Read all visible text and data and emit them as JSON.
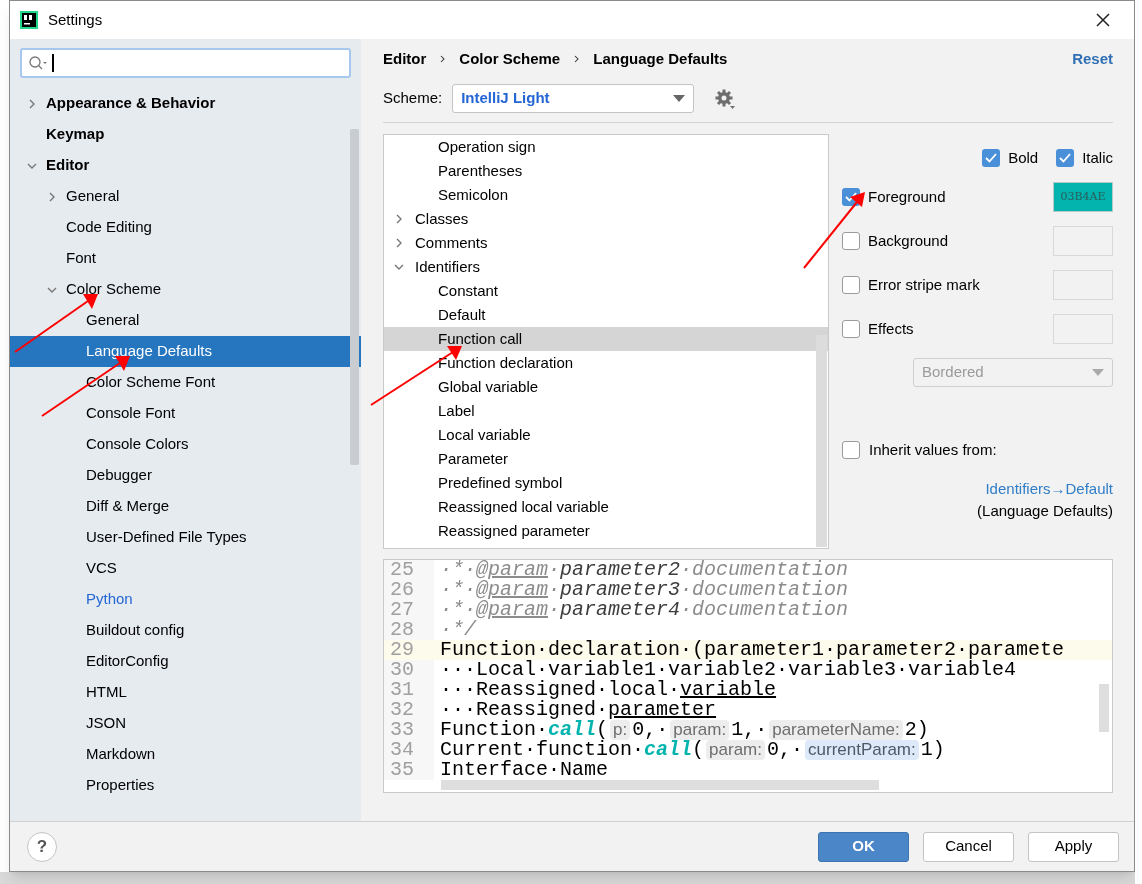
{
  "window": {
    "title": "Settings"
  },
  "sidebar": {
    "items": [
      {
        "label": "Appearance & Behavior",
        "kind": "folder",
        "expanded": false,
        "selected": false,
        "modified": false
      },
      {
        "label": "Keymap",
        "kind": "leaf",
        "selected": false,
        "modified": false
      },
      {
        "label": "Editor",
        "kind": "folder",
        "expanded": true,
        "selected": false,
        "modified": false,
        "children": [
          {
            "label": "General",
            "kind": "folder",
            "expanded": false,
            "selected": false,
            "modified": false
          },
          {
            "label": "Code Editing",
            "kind": "leaf",
            "selected": false,
            "modified": false
          },
          {
            "label": "Font",
            "kind": "leaf",
            "selected": false,
            "modified": false
          },
          {
            "label": "Color Scheme",
            "kind": "folder",
            "expanded": true,
            "selected": false,
            "modified": false,
            "children": [
              {
                "label": "General",
                "kind": "leaf",
                "selected": false,
                "modified": false
              },
              {
                "label": "Language Defaults",
                "kind": "leaf",
                "selected": true,
                "modified": false
              },
              {
                "label": "Color Scheme Font",
                "kind": "leaf",
                "selected": false,
                "modified": false
              },
              {
                "label": "Console Font",
                "kind": "leaf",
                "selected": false,
                "modified": false
              },
              {
                "label": "Console Colors",
                "kind": "leaf",
                "selected": false,
                "modified": false
              },
              {
                "label": "Debugger",
                "kind": "leaf",
                "selected": false,
                "modified": false
              },
              {
                "label": "Diff & Merge",
                "kind": "leaf",
                "selected": false,
                "modified": false
              },
              {
                "label": "User-Defined File Types",
                "kind": "leaf",
                "selected": false,
                "modified": false
              },
              {
                "label": "VCS",
                "kind": "leaf",
                "selected": false,
                "modified": false
              },
              {
                "label": "Python",
                "kind": "leaf",
                "selected": false,
                "modified": true
              },
              {
                "label": "Buildout config",
                "kind": "leaf",
                "selected": false,
                "modified": false
              },
              {
                "label": "EditorConfig",
                "kind": "leaf",
                "selected": false,
                "modified": false
              },
              {
                "label": "HTML",
                "kind": "leaf",
                "selected": false,
                "modified": false
              },
              {
                "label": "JSON",
                "kind": "leaf",
                "selected": false,
                "modified": false
              },
              {
                "label": "Markdown",
                "kind": "leaf",
                "selected": false,
                "modified": false
              },
              {
                "label": "Properties",
                "kind": "leaf",
                "selected": false,
                "modified": false
              }
            ]
          }
        ]
      }
    ]
  },
  "breadcrumb": [
    "Editor",
    "Color Scheme",
    "Language Defaults"
  ],
  "reset_link": "Reset",
  "scheme": {
    "label": "Scheme:",
    "value": "IntelliJ Light"
  },
  "attributes_tree": {
    "items": [
      {
        "kind": "continuation",
        "children": [
          {
            "label": "Operation sign",
            "kind": "leaf",
            "selected": false
          },
          {
            "label": "Parentheses",
            "kind": "leaf",
            "selected": false
          },
          {
            "label": "Semicolon",
            "kind": "leaf",
            "selected": false
          }
        ]
      },
      {
        "label": "Classes",
        "kind": "folder",
        "expanded": false,
        "selected": false
      },
      {
        "label": "Comments",
        "kind": "folder",
        "expanded": false,
        "selected": false
      },
      {
        "label": "Identifiers",
        "kind": "folder",
        "expanded": true,
        "selected": false,
        "children": [
          {
            "label": "Constant",
            "kind": "leaf",
            "selected": false
          },
          {
            "label": "Default",
            "kind": "leaf",
            "selected": false
          },
          {
            "label": "Function call",
            "kind": "leaf",
            "selected": true
          },
          {
            "label": "Function declaration",
            "kind": "leaf",
            "selected": false
          },
          {
            "label": "Global variable",
            "kind": "leaf",
            "selected": false
          },
          {
            "label": "Label",
            "kind": "leaf",
            "selected": false
          },
          {
            "label": "Local variable",
            "kind": "leaf",
            "selected": false
          },
          {
            "label": "Parameter",
            "kind": "leaf",
            "selected": false
          },
          {
            "label": "Predefined symbol",
            "kind": "leaf",
            "selected": false
          },
          {
            "label": "Reassigned local variable",
            "kind": "leaf",
            "selected": false
          },
          {
            "label": "Reassigned parameter",
            "kind": "leaf",
            "selected": false
          }
        ]
      }
    ]
  },
  "font_style": [
    {
      "label": "Bold",
      "checked": true
    },
    {
      "label": "Italic",
      "checked": true
    }
  ],
  "color_options": [
    {
      "label": "Foreground",
      "checked": true,
      "value": "03B4AE",
      "color": "#03b4ae"
    },
    {
      "label": "Background",
      "checked": false
    },
    {
      "label": "Error stripe mark",
      "checked": false
    },
    {
      "label": "Effects",
      "checked": false
    }
  ],
  "effects_dropdown": {
    "value": "Bordered",
    "disabled": true
  },
  "inherit": {
    "label": "Inherit values from:",
    "checked": false,
    "link": "Identifiers→Default",
    "note": "(Language Defaults)"
  },
  "preview": {
    "lines": [
      {
        "number": "25",
        "current": false,
        "segments": [
          {
            "text": "·*·",
            "kind": "comment"
          },
          {
            "text": "@param",
            "kind": "tag"
          },
          {
            "text": "·",
            "kind": "comment"
          },
          {
            "text": "parameter2",
            "kind": "doc-param"
          },
          {
            "text": "·documentation",
            "kind": "comment"
          }
        ]
      },
      {
        "number": "26",
        "current": false,
        "segments": [
          {
            "text": "·*·",
            "kind": "comment"
          },
          {
            "text": "@param",
            "kind": "tag"
          },
          {
            "text": "·",
            "kind": "comment"
          },
          {
            "text": "parameter3",
            "kind": "doc-param"
          },
          {
            "text": "·documentation",
            "kind": "comment"
          }
        ]
      },
      {
        "number": "27",
        "current": false,
        "segments": [
          {
            "text": "·*·",
            "kind": "comment"
          },
          {
            "text": "@param",
            "kind": "tag"
          },
          {
            "text": "·",
            "kind": "comment"
          },
          {
            "text": "parameter4",
            "kind": "doc-param"
          },
          {
            "text": "·documentation",
            "kind": "comment"
          }
        ]
      },
      {
        "number": "28",
        "current": false,
        "segments": [
          {
            "text": "·*/",
            "kind": "comment"
          }
        ]
      },
      {
        "number": "29",
        "current": true,
        "segments": [
          {
            "text": "Function·declaration·(parameter1·parameter2·paramete",
            "kind": "plain"
          }
        ]
      },
      {
        "number": "30",
        "current": false,
        "segments": [
          {
            "text": "···Local·variable1·variable2·variable3·variable4",
            "kind": "plain"
          }
        ]
      },
      {
        "number": "31",
        "current": false,
        "segments": [
          {
            "text": "···Reassigned·local·",
            "kind": "plain"
          },
          {
            "text": "variable",
            "kind": "reassigned"
          }
        ]
      },
      {
        "number": "32",
        "current": false,
        "segments": [
          {
            "text": "···Reassigned·",
            "kind": "plain"
          },
          {
            "text": "parameter",
            "kind": "reassigned"
          }
        ]
      },
      {
        "number": "33",
        "current": false,
        "segments": [
          {
            "text": "Function·",
            "kind": "plain"
          },
          {
            "text": "call",
            "kind": "call"
          },
          {
            "text": "(",
            "kind": "plain"
          },
          {
            "text": "p:",
            "kind": "hint"
          },
          {
            "text": "0,·",
            "kind": "plain"
          },
          {
            "text": "param:",
            "kind": "hint"
          },
          {
            "text": "1,·",
            "kind": "plain"
          },
          {
            "text": "parameterName:",
            "kind": "hint"
          },
          {
            "text": "2)",
            "kind": "plain"
          }
        ]
      },
      {
        "number": "34",
        "current": false,
        "segments": [
          {
            "text": "Current·function·",
            "kind": "plain"
          },
          {
            "text": "call",
            "kind": "call"
          },
          {
            "text": "(",
            "kind": "plain"
          },
          {
            "text": "param:",
            "kind": "hint"
          },
          {
            "text": "0,·",
            "kind": "plain"
          },
          {
            "text": "currentParam:",
            "kind": "hint-current"
          },
          {
            "text": "1)",
            "kind": "plain"
          }
        ]
      },
      {
        "number": "35",
        "current": false,
        "segments": [
          {
            "text": "Interface·Name",
            "kind": "plain"
          }
        ]
      }
    ]
  },
  "buttons": [
    {
      "label": "OK",
      "kind": "primary"
    },
    {
      "label": "Cancel",
      "kind": "default"
    },
    {
      "label": "Apply",
      "kind": "default"
    }
  ],
  "help_button": "?"
}
